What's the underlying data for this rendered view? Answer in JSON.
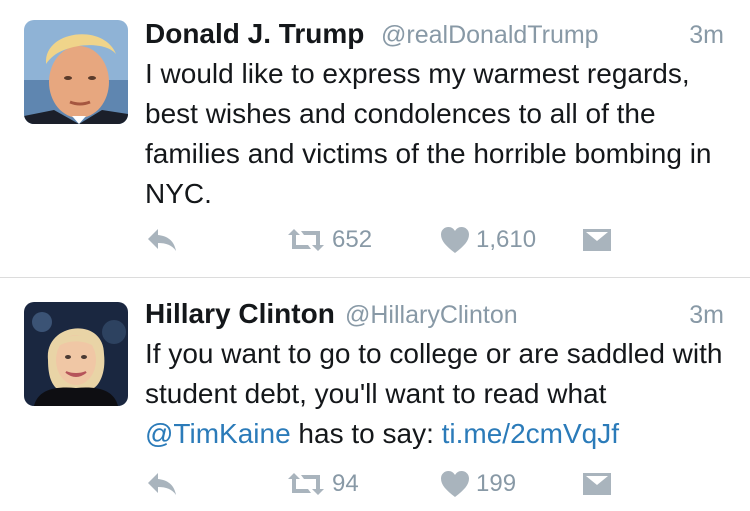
{
  "colors": {
    "text": "#14171a",
    "muted": "#8899a6",
    "link": "#2b7bb9",
    "icon": "#a9b4bd",
    "divider": "#dcdcdc"
  },
  "tweets": [
    {
      "name": "Donald J. Trump",
      "handle": "@realDonaldTrump",
      "time": "3m",
      "text": "I would like to express my warmest regards, best wishes and condolences to all of the families and victims of the horrible bombing in NYC.",
      "retweets": "652",
      "likes": "1,610",
      "icons": {
        "reply": "reply-icon",
        "retweet": "retweet-icon",
        "like": "heart-icon",
        "dm": "envelope-icon"
      }
    },
    {
      "name": "Hillary Clinton",
      "handle": "@HillaryClinton",
      "time": "3m",
      "text_prefix": "If you want to go to college or are saddled with student debt, you'll want to read what ",
      "mention": "@TimKaine",
      "text_middle": " has to say: ",
      "link": "ti.me/2cmVqJf",
      "retweets": "94",
      "likes": "199",
      "icons": {
        "reply": "reply-icon",
        "retweet": "retweet-icon",
        "like": "heart-icon",
        "dm": "envelope-icon"
      }
    }
  ]
}
